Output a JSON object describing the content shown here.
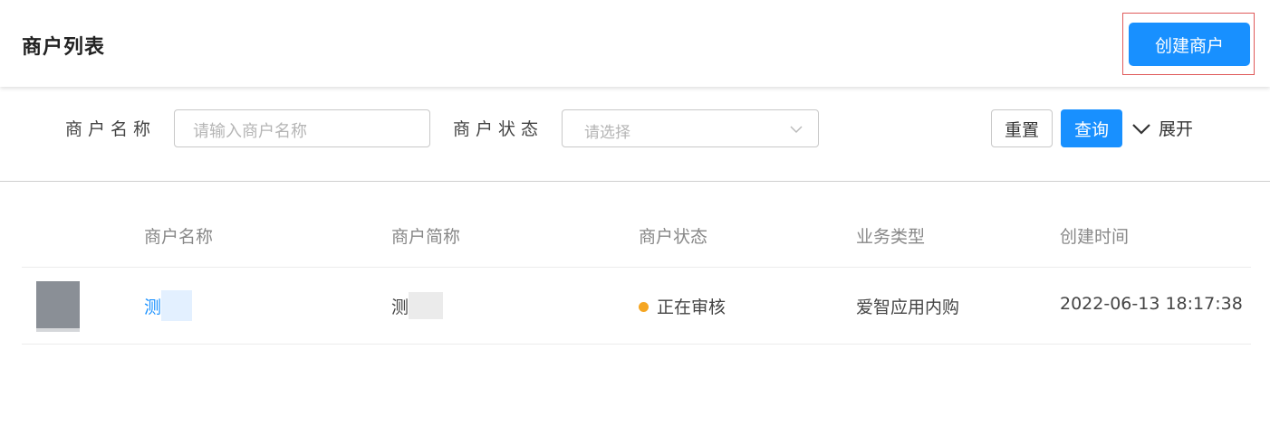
{
  "header": {
    "title": "商户列表",
    "create_button": "创建商户"
  },
  "filters": {
    "name_label": "商户名称",
    "name_placeholder": "请输入商户名称",
    "status_label": "商户状态",
    "status_placeholder": "请选择",
    "reset_label": "重置",
    "query_label": "查询",
    "expand_label": "展开"
  },
  "table": {
    "columns": [
      "商户名称",
      "商户简称",
      "商户状态",
      "业务类型",
      "创建时间"
    ],
    "rows": [
      {
        "name": "测",
        "short_name": "测",
        "status": "正在审核",
        "business_type": "爱智应用内购",
        "created_at": "2022-06-13 18:17:38"
      }
    ]
  },
  "colors": {
    "primary": "#1890ff",
    "status_pending": "#f5a623",
    "highlight_border": "#e05a5a"
  }
}
